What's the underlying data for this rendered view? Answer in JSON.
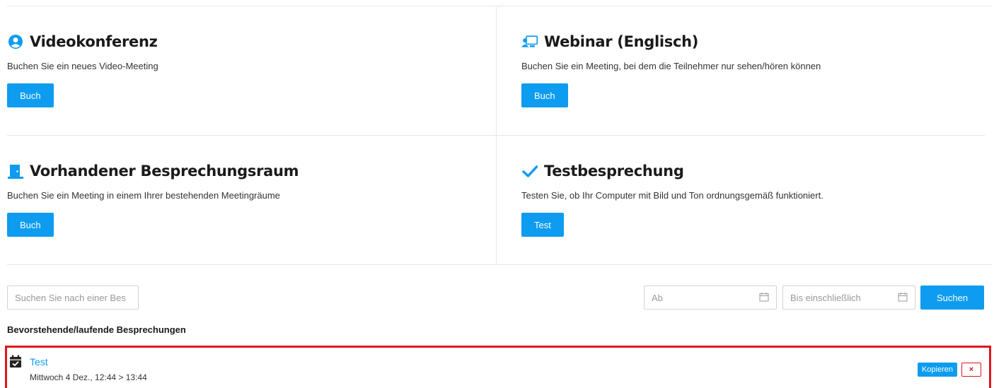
{
  "cards": [
    {
      "title": "Videokonferenz",
      "description": "Buchen Sie ein neues Video-Meeting",
      "button": "Buch",
      "icon": "user-circle-icon"
    },
    {
      "title": "Webinar (Englisch)",
      "description": "Buchen Sie ein Meeting, bei dem die Teilnehmer nur sehen/hören können",
      "button": "Buch",
      "icon": "presentation-screen-icon"
    },
    {
      "title": "Vorhandener Besprechungsraum",
      "description": "Buchen Sie ein Meeting in einem Ihrer bestehenden Meetingräume",
      "button": "Buch",
      "icon": "door-icon"
    },
    {
      "title": "Testbesprechung",
      "description": "Testen Sie, ob Ihr Computer mit Bild und Ton ordnungsgemäß funktioniert.",
      "button": "Test",
      "icon": "checkmark-icon"
    }
  ],
  "search": {
    "placeholder": "Suchen Sie nach einer Bes",
    "from_placeholder": "Ab",
    "to_placeholder": "Bis einschließlich",
    "button": "Suchen"
  },
  "upcoming": {
    "heading": "Bevorstehende/laufende Besprechungen",
    "meetings": [
      {
        "title": "Test",
        "time": "Mittwoch 4 Dez., 12:44 > 13:44",
        "copy_label": "Kopieren",
        "delete_label": "×"
      }
    ]
  },
  "colors": {
    "accent": "#0d9cf0",
    "highlight_border": "#e0141e",
    "delete": "#e0141e"
  }
}
